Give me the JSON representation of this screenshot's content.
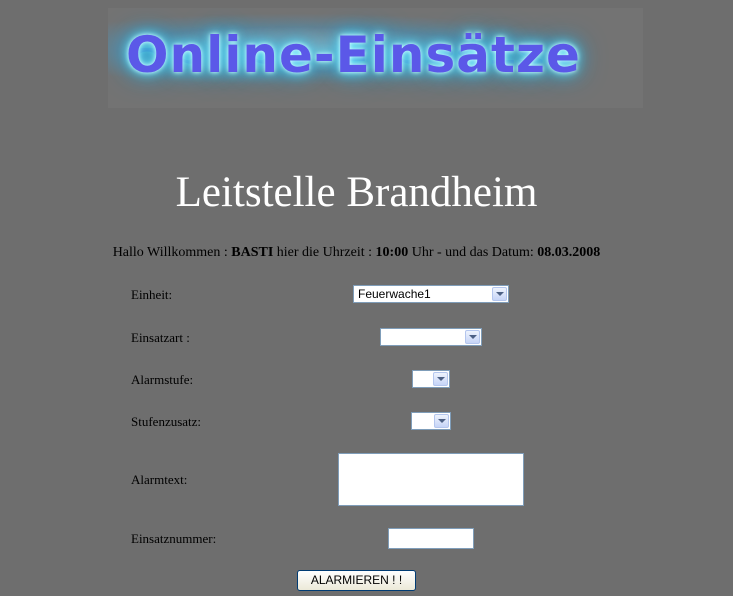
{
  "logo": {
    "text": "Online-Einsätze"
  },
  "page_title": "Leitstelle Brandheim",
  "welcome": {
    "prefix": "Hallo Willkommen :",
    "user": "BASTI",
    "time_prefix": "hier die Uhrzeit :",
    "time": "10:00",
    "date_prefix": "Uhr - und das Datum:",
    "date": "08.03.2008"
  },
  "form": {
    "einheit_label": "Einheit:",
    "einheit_value": "Feuerwache1",
    "einsatzart_label": "Einsatzart :",
    "einsatzart_value": "",
    "alarmstufe_label": "Alarmstufe:",
    "alarmstufe_value": "",
    "stufenzusatz_label": "Stufenzusatz:",
    "stufenzusatz_value": "",
    "alarmtext_label": "Alarmtext:",
    "alarmtext_value": "",
    "einsatznummer_label": "Einsatznummer:",
    "einsatznummer_value": "",
    "submit_label": "ALARMIEREN ! !"
  },
  "icons": {
    "dropdown": "chevron-down-icon"
  }
}
